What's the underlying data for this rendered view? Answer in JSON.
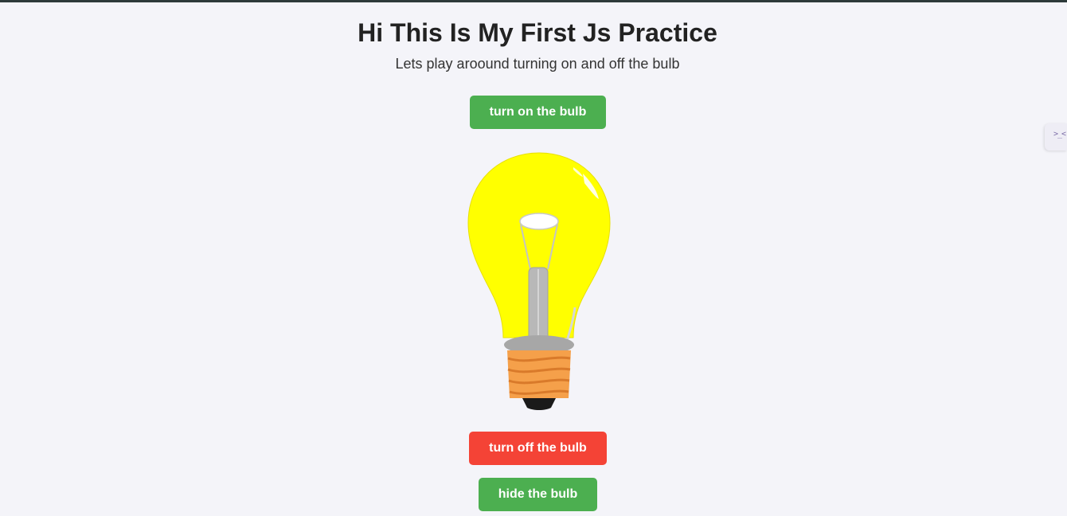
{
  "page": {
    "title": "Hi This Is My First Js Practice",
    "subtitle": "Lets play aroound turning on and off the bulb"
  },
  "buttons": {
    "turn_on": "turn on the bulb",
    "turn_off": "turn off the bulb",
    "hide": "hide the bulb"
  },
  "bulb": {
    "state": "on",
    "glass_color": "#ffff00",
    "base_color": "#f5a04a"
  },
  "colors": {
    "on_button": "#4caf50",
    "off_button": "#f44336",
    "background": "#f4f4f9"
  },
  "side_widget": {
    "icon": "code-icon"
  }
}
